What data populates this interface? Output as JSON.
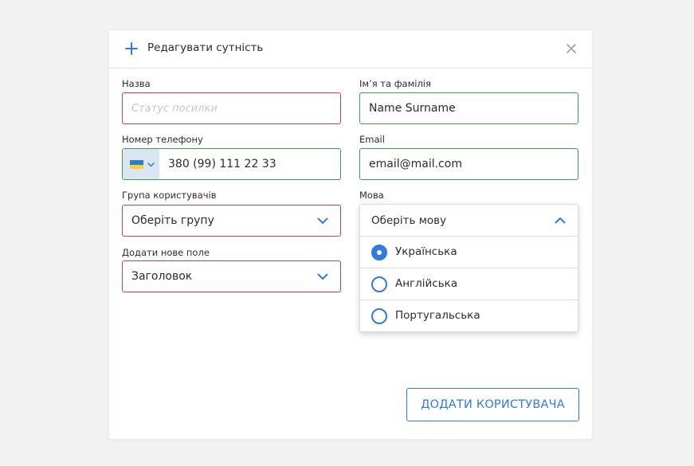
{
  "header": {
    "title": "Редагувати сутність",
    "icons": {
      "add": "plus-icon",
      "close": "close-icon"
    }
  },
  "form": {
    "name": {
      "label": "Назва",
      "value": "",
      "placeholder": "Статус посилки",
      "status": "error"
    },
    "full_name": {
      "label": "Ім’я та фамілія",
      "value": "Name Surname",
      "status": "valid"
    },
    "phone": {
      "label": "Номер телефону",
      "country_flag": "ukraine-flag-icon",
      "value": "380 (99) 111 22 33",
      "status": "valid"
    },
    "email": {
      "label": "Email",
      "value": "email@mail.com",
      "status": "valid"
    },
    "user_group": {
      "label": "Група користувачів",
      "selected": "Оберіть групу",
      "status": "error"
    },
    "new_field": {
      "label": "Додати нове поле",
      "selected": "Заголовок",
      "status": "error"
    },
    "language": {
      "label": "Мова",
      "selected": "Оберіть мову",
      "expanded": true,
      "options": [
        {
          "label": "Українська",
          "checked": true
        },
        {
          "label": "Англійська",
          "checked": false
        },
        {
          "label": "Португальська",
          "checked": false
        }
      ]
    }
  },
  "actions": {
    "submit_label": "ДОДАТИ КОРИСТУВАЧА"
  },
  "colors": {
    "accent": "#2f7be0",
    "error_border": "#d83b4f",
    "valid_border": "#3aa14a",
    "background": "#f2f2f2"
  }
}
